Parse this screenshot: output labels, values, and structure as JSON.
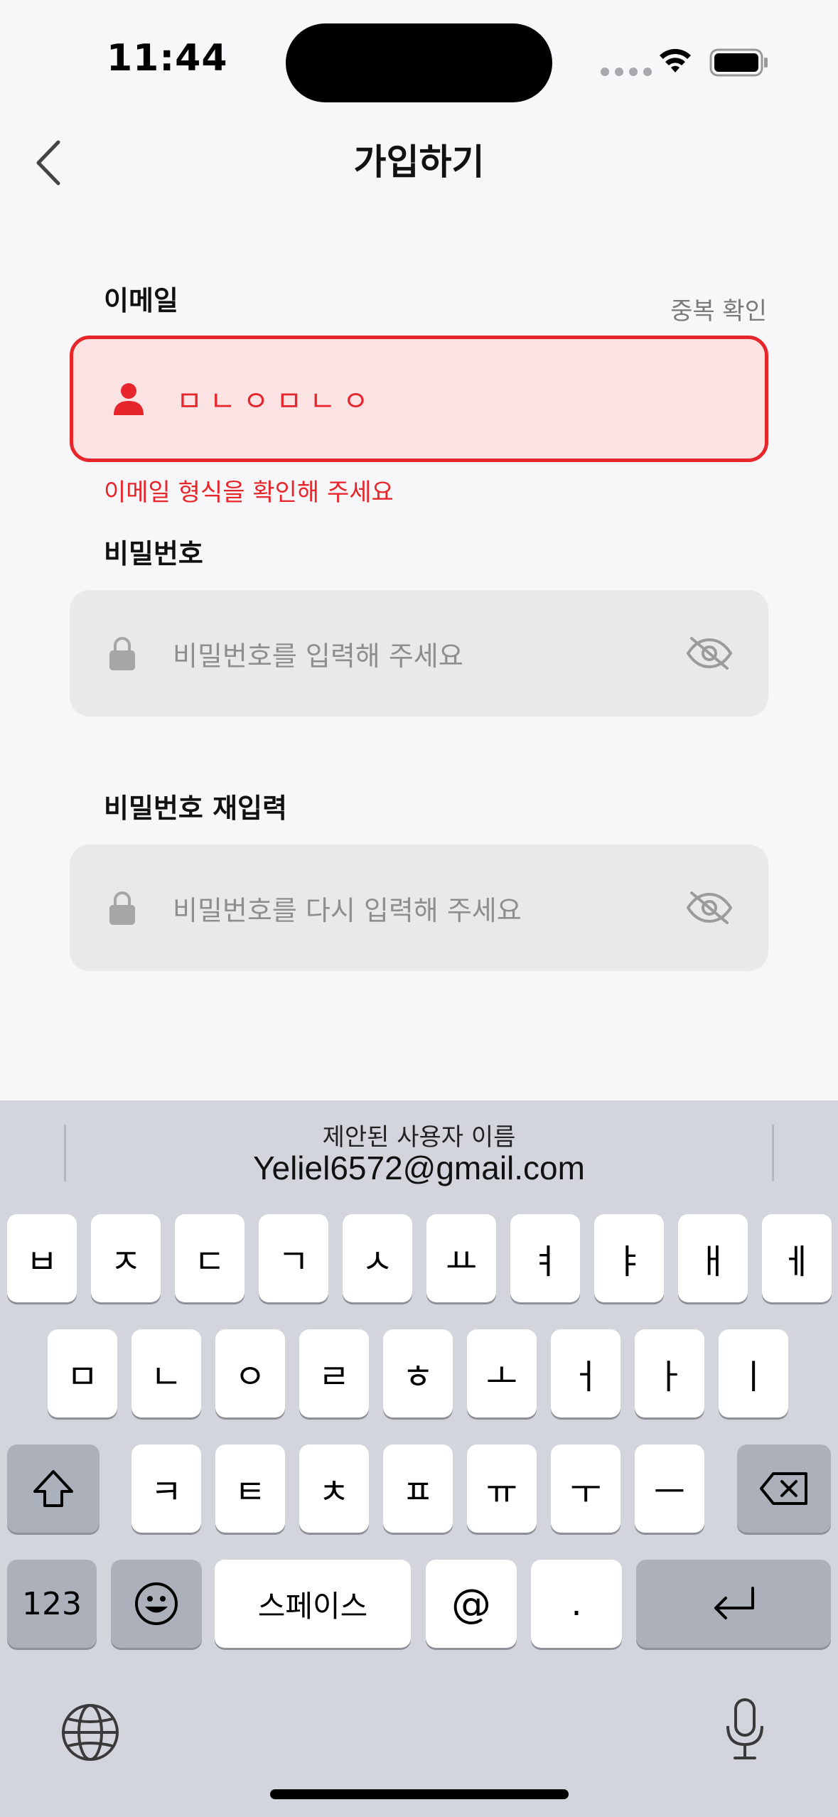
{
  "status_bar": {
    "time": "11:44"
  },
  "nav": {
    "title": "가입하기"
  },
  "email": {
    "label": "이메일",
    "duplicate_check": "중복 확인",
    "value": "ㅁㄴㅇㅁㄴㅇ",
    "error": "이메일 형식을 확인해 주세요"
  },
  "password": {
    "label": "비밀번호",
    "placeholder": "비밀번호를 입력해 주세요"
  },
  "password_confirm": {
    "label": "비밀번호 재입력",
    "placeholder": "비밀번호를 다시 입력해 주세요"
  },
  "keyboard": {
    "suggestion_title": "제안된 사용자 이름",
    "suggestion_value": "Yeliel6572@gmail.com",
    "row1": [
      "ㅂ",
      "ㅈ",
      "ㄷ",
      "ㄱ",
      "ㅅ",
      "ㅛ",
      "ㅕ",
      "ㅑ",
      "ㅐ",
      "ㅔ"
    ],
    "row2": [
      "ㅁ",
      "ㄴ",
      "ㅇ",
      "ㄹ",
      "ㅎ",
      "ㅗ",
      "ㅓ",
      "ㅏ",
      "ㅣ"
    ],
    "row3": [
      "ㅋ",
      "ㅌ",
      "ㅊ",
      "ㅍ",
      "ㅠ",
      "ㅜ",
      "ㅡ"
    ],
    "numbers": "123",
    "space": "스페이스",
    "at": "@",
    "dot": "."
  },
  "colors": {
    "error": "#e7262c",
    "error_bg": "#fbe2e3",
    "field_bg": "#e9e9e9"
  }
}
